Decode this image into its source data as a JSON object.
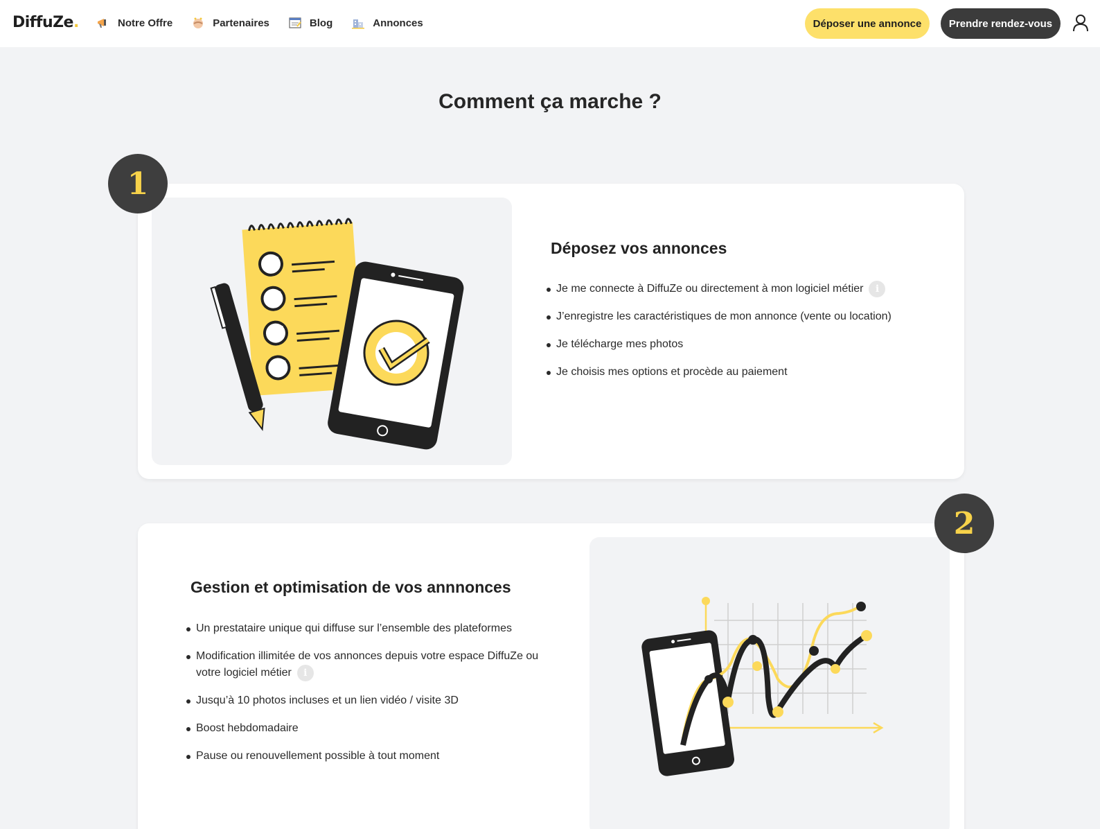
{
  "header": {
    "logo": "DiffuZe",
    "logo_dot": ".",
    "nav": [
      {
        "label": "Notre Offre",
        "icon": "megaphone-icon"
      },
      {
        "label": "Partenaires",
        "icon": "handshake-icon"
      },
      {
        "label": "Blog",
        "icon": "notepad-icon"
      },
      {
        "label": "Annonces",
        "icon": "buildings-icon"
      }
    ],
    "cta_primary": "Déposer une annonce",
    "cta_secondary": "Prendre rendez-vous",
    "user_icon": "user-icon"
  },
  "page": {
    "title": "Comment ça marche ?"
  },
  "steps": [
    {
      "number": "1",
      "title": "Déposez vos annonces",
      "bullets": [
        "Je me connecte à DiffuZe ou directement à mon logiciel métier",
        "J’enregistre les caractéristiques de mon annonce (vente ou location)",
        "Je télécharge mes photos",
        "Je choisis mes options et procède au paiement"
      ],
      "info_icon": "i"
    },
    {
      "number": "2",
      "title": "Gestion et optimisation de vos annnonces",
      "bullets": [
        "Un prestataire unique qui diffuse sur l’ensemble des plateformes",
        "Modification illimitée de vos annonces depuis votre espace DiffuZe ou votre logiciel métier",
        "Jusqu’à 10 photos incluses et un lien vidéo / visite 3D",
        "Boost hebdomadaire",
        "Pause ou renouvellement possible à tout moment"
      ],
      "info_icon": "i"
    }
  ],
  "colors": {
    "accent_yellow": "#fde06a",
    "dark": "#3b3b3b",
    "badge_number": "#f7d24a",
    "background": "#f2f3f5"
  }
}
